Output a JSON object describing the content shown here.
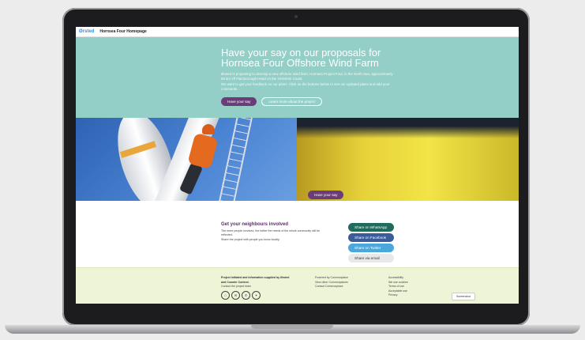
{
  "header": {
    "logo": "Ørsted",
    "title": "Hornsea Four Homepage"
  },
  "hero": {
    "heading": "Have your say on our proposals for Hornsea Four Offshore Wind Farm",
    "para1": "Ørsted is proposing to develop a new offshore wind farm, Hornsea Project Four, in the North Sea, approximately 65 km off Flamborough Head on the Yorkshire Coast.",
    "para2": "We want to get your feedback on our plans. Click on the buttons below to see our updated plans and add your comments.",
    "primary_btn": "Have your say",
    "secondary_btn": "Learn more about the project"
  },
  "photo": {
    "btn": "Have your say"
  },
  "share": {
    "heading": "Get your neighbours involved",
    "text1": "The more people involved, the better the needs of the whole community will be reflected.",
    "text2": "Share the project with people you know locally.",
    "whatsapp": "Share on WhatsApp",
    "facebook": "Share on Facebook",
    "twitter": "Share on Twitter",
    "email": "Share via email"
  },
  "footer": {
    "col1_line1": "Project initiated and information supplied by Ørsted and Counter Context.",
    "col1_link": "Contact the project team",
    "col2": [
      "Powered by Commonplace",
      "View other Commonplaces",
      "Contact Commonplace"
    ],
    "col3": [
      "Accessibility",
      "We use cookies",
      "Terms of use",
      "Acceptable use",
      "Privacy"
    ],
    "screenshot_btn": "Screenshot"
  },
  "icons": [
    "chat-icon",
    "mail-icon",
    "phone-icon",
    "twitter-icon"
  ],
  "colors": {
    "hero": "#93cfc6",
    "brand_purple": "#6a3d78",
    "footer": "#eef4d6"
  }
}
